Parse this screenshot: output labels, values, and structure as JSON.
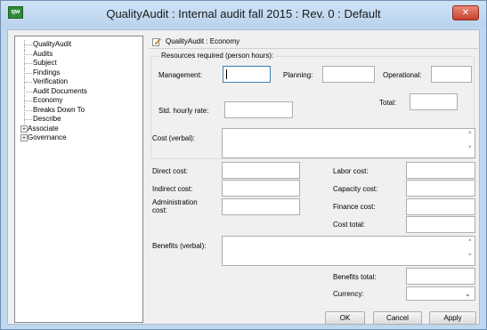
{
  "window": {
    "app_icon": "qw",
    "title": "QualityAudit : Internal audit fall 2015 : Rev. 0  : Default",
    "close_glyph": "✕"
  },
  "tree": {
    "items": [
      {
        "label": "QualityAudit",
        "expander": ""
      },
      {
        "label": "Audits",
        "expander": ""
      },
      {
        "label": "Subject",
        "expander": ""
      },
      {
        "label": "Findings",
        "expander": ""
      },
      {
        "label": "Verification",
        "expander": ""
      },
      {
        "label": "Audit Documents",
        "expander": ""
      },
      {
        "label": "Economy",
        "expander": "",
        "selected": true
      },
      {
        "label": "Breaks Down To",
        "expander": ""
      },
      {
        "label": "Describe",
        "expander": ""
      },
      {
        "label": "Associate",
        "expander": "+"
      },
      {
        "label": "Governance",
        "expander": "+"
      }
    ]
  },
  "panel": {
    "breadcrumb": "QualityAudit : Economy",
    "resources_group": "Resources required (person hours):",
    "labels": {
      "management": "Management:",
      "planning": "Planning:",
      "operational": "Operational:",
      "total": "Total:",
      "std_hourly_rate": "Std. hourly rate:",
      "cost_verbal": "Cost (verbal):",
      "direct_cost": "Direct cost:",
      "labor_cost": "Labor cost:",
      "indirect_cost": "Indirect cost:",
      "capacity_cost": "Capacity cost:",
      "administration_cost_line1": "Administration",
      "administration_cost_line2": "cost:",
      "finance_cost": "Finance cost:",
      "cost_total": "Cost total:",
      "benefits_verbal": "Benefits (verbal):",
      "benefits_total": "Benefits total:",
      "currency": "Currency:"
    },
    "values": {
      "management": "",
      "planning": "",
      "operational": "",
      "total": "",
      "std_hourly_rate": "",
      "cost_verbal": "",
      "direct_cost": "",
      "labor_cost": "",
      "indirect_cost": "",
      "capacity_cost": "",
      "administration_cost": "",
      "finance_cost": "",
      "cost_total": "",
      "benefits_verbal": "",
      "benefits_total": "",
      "currency": ""
    }
  },
  "buttons": {
    "ok": "OK",
    "cancel": "Cancel",
    "apply": "Apply"
  },
  "glyphs": {
    "scroll_up": "˄",
    "scroll_down": "˅",
    "dropdown": "⌄"
  }
}
